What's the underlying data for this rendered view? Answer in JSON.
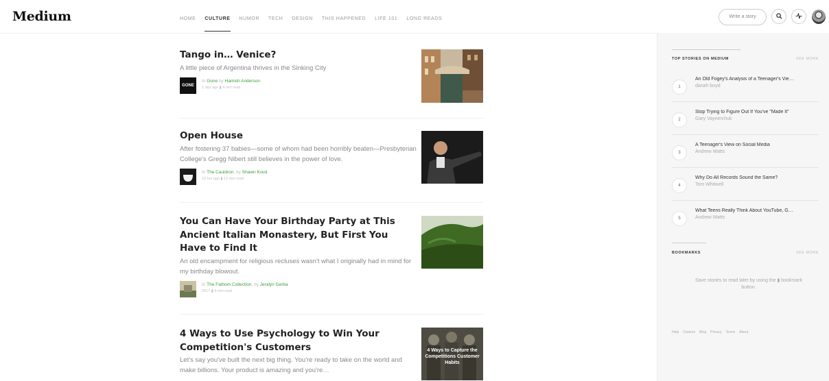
{
  "brand": {
    "logo": "Medium"
  },
  "nav": {
    "items": [
      "HOME",
      "CULTURE",
      "HUMOR",
      "TECH",
      "DESIGN",
      "THIS HAPPENED",
      "LIFE 101",
      "LONG READS"
    ],
    "active": "CULTURE"
  },
  "header": {
    "write_label": "Write a story",
    "search_icon": "search-icon",
    "activity_icon": "activity-icon"
  },
  "articles": [
    {
      "title": "Tango in… Venice?",
      "subtitle": "A little piece of Argentina thrives in the Sinking City",
      "publication": "Gone",
      "pub_badge": "GONE",
      "author": "Hamish Anderson",
      "meta": "1 day ago  ▮  4 min read"
    },
    {
      "title": "Open House",
      "subtitle": "After fostering 37 babies—some of whom had been horribly beaten—Presbyterian College's Gregg Nibert still believes in the power of love.",
      "publication": "The Cauldron",
      "author": "Shawn Krest",
      "meta": "10 hrs ago  ▮  12 min read"
    },
    {
      "title": "You Can Have Your Birthday Party at This Ancient Italian Monastery, But First You Have to Find It",
      "subtitle": "An old encampment for religious recluses wasn't what I originally had in mind for my birthday blowout.",
      "publication": "The Fathom Collection",
      "author": "Jeralyn Gerba",
      "meta": "2017  ▮  4 min read"
    },
    {
      "title": "4 Ways to Use Psychology to Win Your Competition's Customers",
      "subtitle": "Let's say you've built the next big thing. You're ready to take on the world and make billions. Your product is amazing and you're…",
      "thumb_text": "4 Ways to Capture the Competitions Customer Habits"
    }
  ],
  "sidebar": {
    "top_stories_title": "TOP STORIES ON MEDIUM",
    "see_more": "SEE MORE",
    "stories": [
      {
        "num": "1",
        "title": "An Old Fogey's Analysis of a Teenager's Vie…",
        "author": "danah boyd"
      },
      {
        "num": "2",
        "title": "Stop Trying to Figure Out If You've \"Made It\"",
        "author": "Gary Vaynerchuk"
      },
      {
        "num": "3",
        "title": "A Teenager's View on Social Media",
        "author": "Andrew Watts"
      },
      {
        "num": "4",
        "title": "Why Do All Records Sound the Same?",
        "author": "Tom Whitwell"
      },
      {
        "num": "5",
        "title": "What Teens Really Think About YouTube, G…",
        "author": "Andrew Watts"
      }
    ],
    "bookmarks_title": "BOOKMARKS",
    "bookmarks_text": "Save stories to read later by using the ▮ bookmark button.",
    "footer": [
      "Help",
      "Careers",
      "Blog",
      "Privacy",
      "Terms",
      "About"
    ]
  }
}
